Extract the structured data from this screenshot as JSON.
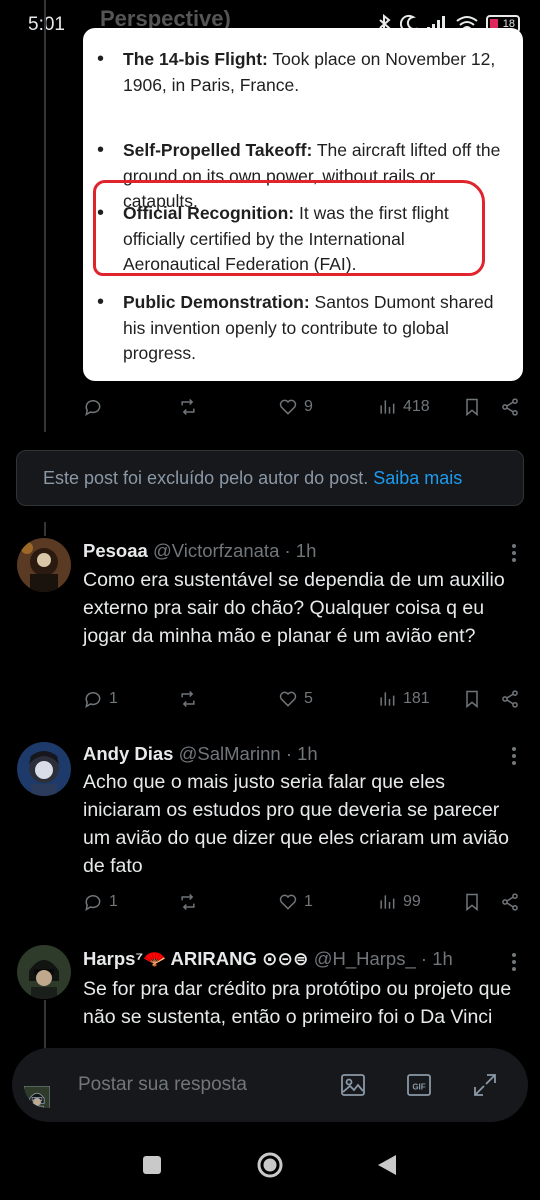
{
  "status_bar": {
    "time": "5:01",
    "behind_text": "Perspective)",
    "battery": "18"
  },
  "card": {
    "items": [
      {
        "bold": "The 14-bis Flight:",
        "text": " Took place on November 12, 1906, in Paris, France."
      },
      {
        "bold": "Self-Propelled Takeoff:",
        "text": " The aircraft lifted off the ground on its own power, without rails or catapults."
      },
      {
        "bold": "Official Recognition:",
        "text": " It was the first flight officially certified by the International Aeronautical Federation (FAI)."
      },
      {
        "bold": "Public Demonstration:",
        "text": " Santos Dumont shared his invention openly to contribute to global progress."
      }
    ]
  },
  "post_actions": {
    "likes": "9",
    "views": "418"
  },
  "deleted_notice": {
    "text": "Este post foi excluído pelo autor do post.",
    "link": "Saiba mais"
  },
  "replies": [
    {
      "name": "Pesoaa",
      "handle": "@Victorfzanata",
      "time": "· 1h",
      "text": "Como era sustentável se dependia de um auxilio externo pra sair do chão? Qualquer coisa q eu jogar da minha mão e planar é um avião ent?",
      "replies": "1",
      "likes": "5",
      "views": "181"
    },
    {
      "name": "Andy Dias",
      "handle": "@SalMarinn",
      "time": "· 1h",
      "text": "Acho que o mais justo seria falar que eles iniciaram os estudos pro que deveria se parecer um avião do que dizer que eles criaram um avião de fato",
      "replies": "1",
      "likes": "1",
      "views": "99"
    },
    {
      "name": "Harps⁷🪭 ARIRANG ⊙⊝⊜",
      "handle": "@H_Harps_",
      "time": "· 1h",
      "text": "Se for pra dar crédito pra protótipo ou projeto que não se sustenta, então o primeiro foi o Da Vinci"
    }
  ],
  "composer": {
    "placeholder": "Postar sua resposta",
    "gif_label": "GIF"
  },
  "colors": {
    "accent": "#1d9bf0",
    "highlight": "#e0242d",
    "card_bg": "#ffffff"
  }
}
